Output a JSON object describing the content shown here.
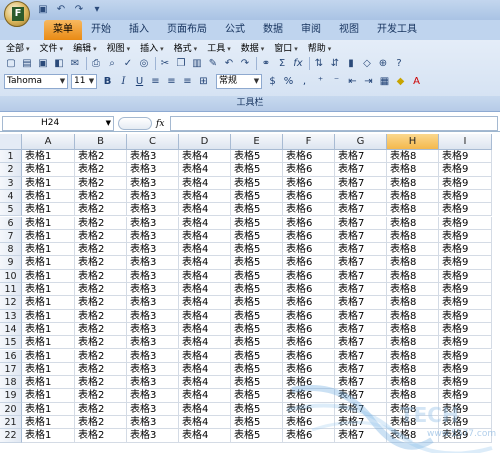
{
  "quick_access": {
    "icons": [
      "save-icon",
      "undo-icon",
      "redo-icon",
      "dropdown-icon"
    ]
  },
  "office_logo": "F",
  "tabs": [
    "菜单",
    "开始",
    "插入",
    "页面布局",
    "公式",
    "数据",
    "审阅",
    "视图",
    "开发工具"
  ],
  "active_tab": 0,
  "menus": [
    "全部",
    "文件",
    "编辑",
    "视图",
    "插入",
    "格式",
    "工具",
    "数据",
    "窗口",
    "帮助"
  ],
  "font": {
    "name": "Tahoma",
    "size": "11"
  },
  "style_combo": "常规",
  "group_label": "工具栏",
  "name_box": "H24",
  "formula_symbol": "fx",
  "formula_value": "",
  "columns": [
    "A",
    "B",
    "C",
    "D",
    "E",
    "F",
    "G",
    "H",
    "I"
  ],
  "selected_column": "H",
  "rows": [
    "1",
    "2",
    "3",
    "4",
    "5",
    "6",
    "7",
    "8",
    "9",
    "10",
    "11",
    "12",
    "13",
    "14",
    "15",
    "16",
    "17",
    "18",
    "19",
    "20",
    "21",
    "22"
  ],
  "row_values": [
    "表格1",
    "表格2",
    "表格3",
    "表格4",
    "表格5",
    "表格6",
    "表格7",
    "表格8",
    "表格9"
  ],
  "watermark_text": "www.5577.com"
}
